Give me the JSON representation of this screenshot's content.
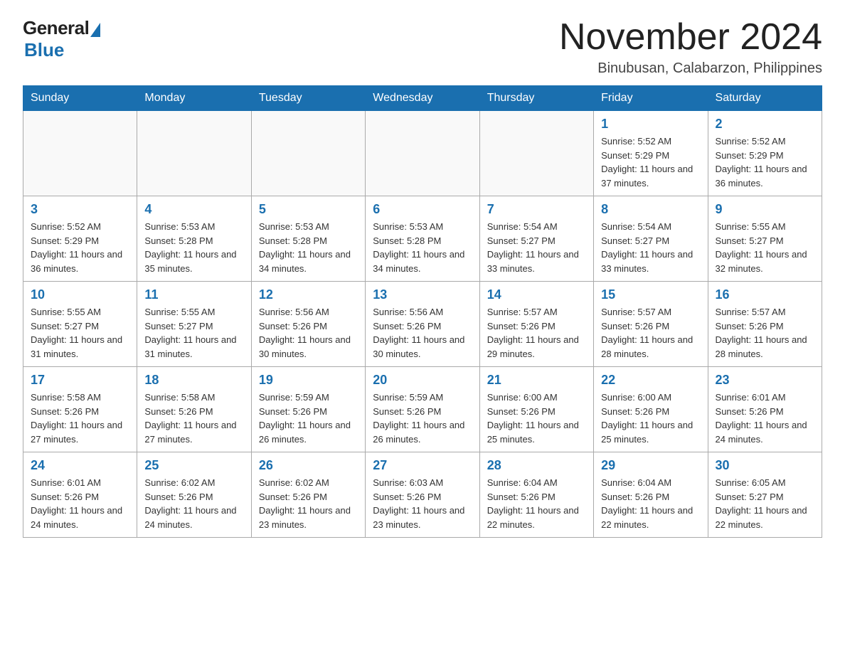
{
  "logo": {
    "general": "General",
    "blue": "Blue"
  },
  "header": {
    "month_title": "November 2024",
    "location": "Binubusan, Calabarzon, Philippines"
  },
  "days_of_week": [
    "Sunday",
    "Monday",
    "Tuesday",
    "Wednesday",
    "Thursday",
    "Friday",
    "Saturday"
  ],
  "weeks": [
    [
      {
        "day": "",
        "info": ""
      },
      {
        "day": "",
        "info": ""
      },
      {
        "day": "",
        "info": ""
      },
      {
        "day": "",
        "info": ""
      },
      {
        "day": "",
        "info": ""
      },
      {
        "day": "1",
        "info": "Sunrise: 5:52 AM\nSunset: 5:29 PM\nDaylight: 11 hours and 37 minutes."
      },
      {
        "day": "2",
        "info": "Sunrise: 5:52 AM\nSunset: 5:29 PM\nDaylight: 11 hours and 36 minutes."
      }
    ],
    [
      {
        "day": "3",
        "info": "Sunrise: 5:52 AM\nSunset: 5:29 PM\nDaylight: 11 hours and 36 minutes."
      },
      {
        "day": "4",
        "info": "Sunrise: 5:53 AM\nSunset: 5:28 PM\nDaylight: 11 hours and 35 minutes."
      },
      {
        "day": "5",
        "info": "Sunrise: 5:53 AM\nSunset: 5:28 PM\nDaylight: 11 hours and 34 minutes."
      },
      {
        "day": "6",
        "info": "Sunrise: 5:53 AM\nSunset: 5:28 PM\nDaylight: 11 hours and 34 minutes."
      },
      {
        "day": "7",
        "info": "Sunrise: 5:54 AM\nSunset: 5:27 PM\nDaylight: 11 hours and 33 minutes."
      },
      {
        "day": "8",
        "info": "Sunrise: 5:54 AM\nSunset: 5:27 PM\nDaylight: 11 hours and 33 minutes."
      },
      {
        "day": "9",
        "info": "Sunrise: 5:55 AM\nSunset: 5:27 PM\nDaylight: 11 hours and 32 minutes."
      }
    ],
    [
      {
        "day": "10",
        "info": "Sunrise: 5:55 AM\nSunset: 5:27 PM\nDaylight: 11 hours and 31 minutes."
      },
      {
        "day": "11",
        "info": "Sunrise: 5:55 AM\nSunset: 5:27 PM\nDaylight: 11 hours and 31 minutes."
      },
      {
        "day": "12",
        "info": "Sunrise: 5:56 AM\nSunset: 5:26 PM\nDaylight: 11 hours and 30 minutes."
      },
      {
        "day": "13",
        "info": "Sunrise: 5:56 AM\nSunset: 5:26 PM\nDaylight: 11 hours and 30 minutes."
      },
      {
        "day": "14",
        "info": "Sunrise: 5:57 AM\nSunset: 5:26 PM\nDaylight: 11 hours and 29 minutes."
      },
      {
        "day": "15",
        "info": "Sunrise: 5:57 AM\nSunset: 5:26 PM\nDaylight: 11 hours and 28 minutes."
      },
      {
        "day": "16",
        "info": "Sunrise: 5:57 AM\nSunset: 5:26 PM\nDaylight: 11 hours and 28 minutes."
      }
    ],
    [
      {
        "day": "17",
        "info": "Sunrise: 5:58 AM\nSunset: 5:26 PM\nDaylight: 11 hours and 27 minutes."
      },
      {
        "day": "18",
        "info": "Sunrise: 5:58 AM\nSunset: 5:26 PM\nDaylight: 11 hours and 27 minutes."
      },
      {
        "day": "19",
        "info": "Sunrise: 5:59 AM\nSunset: 5:26 PM\nDaylight: 11 hours and 26 minutes."
      },
      {
        "day": "20",
        "info": "Sunrise: 5:59 AM\nSunset: 5:26 PM\nDaylight: 11 hours and 26 minutes."
      },
      {
        "day": "21",
        "info": "Sunrise: 6:00 AM\nSunset: 5:26 PM\nDaylight: 11 hours and 25 minutes."
      },
      {
        "day": "22",
        "info": "Sunrise: 6:00 AM\nSunset: 5:26 PM\nDaylight: 11 hours and 25 minutes."
      },
      {
        "day": "23",
        "info": "Sunrise: 6:01 AM\nSunset: 5:26 PM\nDaylight: 11 hours and 24 minutes."
      }
    ],
    [
      {
        "day": "24",
        "info": "Sunrise: 6:01 AM\nSunset: 5:26 PM\nDaylight: 11 hours and 24 minutes."
      },
      {
        "day": "25",
        "info": "Sunrise: 6:02 AM\nSunset: 5:26 PM\nDaylight: 11 hours and 24 minutes."
      },
      {
        "day": "26",
        "info": "Sunrise: 6:02 AM\nSunset: 5:26 PM\nDaylight: 11 hours and 23 minutes."
      },
      {
        "day": "27",
        "info": "Sunrise: 6:03 AM\nSunset: 5:26 PM\nDaylight: 11 hours and 23 minutes."
      },
      {
        "day": "28",
        "info": "Sunrise: 6:04 AM\nSunset: 5:26 PM\nDaylight: 11 hours and 22 minutes."
      },
      {
        "day": "29",
        "info": "Sunrise: 6:04 AM\nSunset: 5:26 PM\nDaylight: 11 hours and 22 minutes."
      },
      {
        "day": "30",
        "info": "Sunrise: 6:05 AM\nSunset: 5:27 PM\nDaylight: 11 hours and 22 minutes."
      }
    ]
  ]
}
